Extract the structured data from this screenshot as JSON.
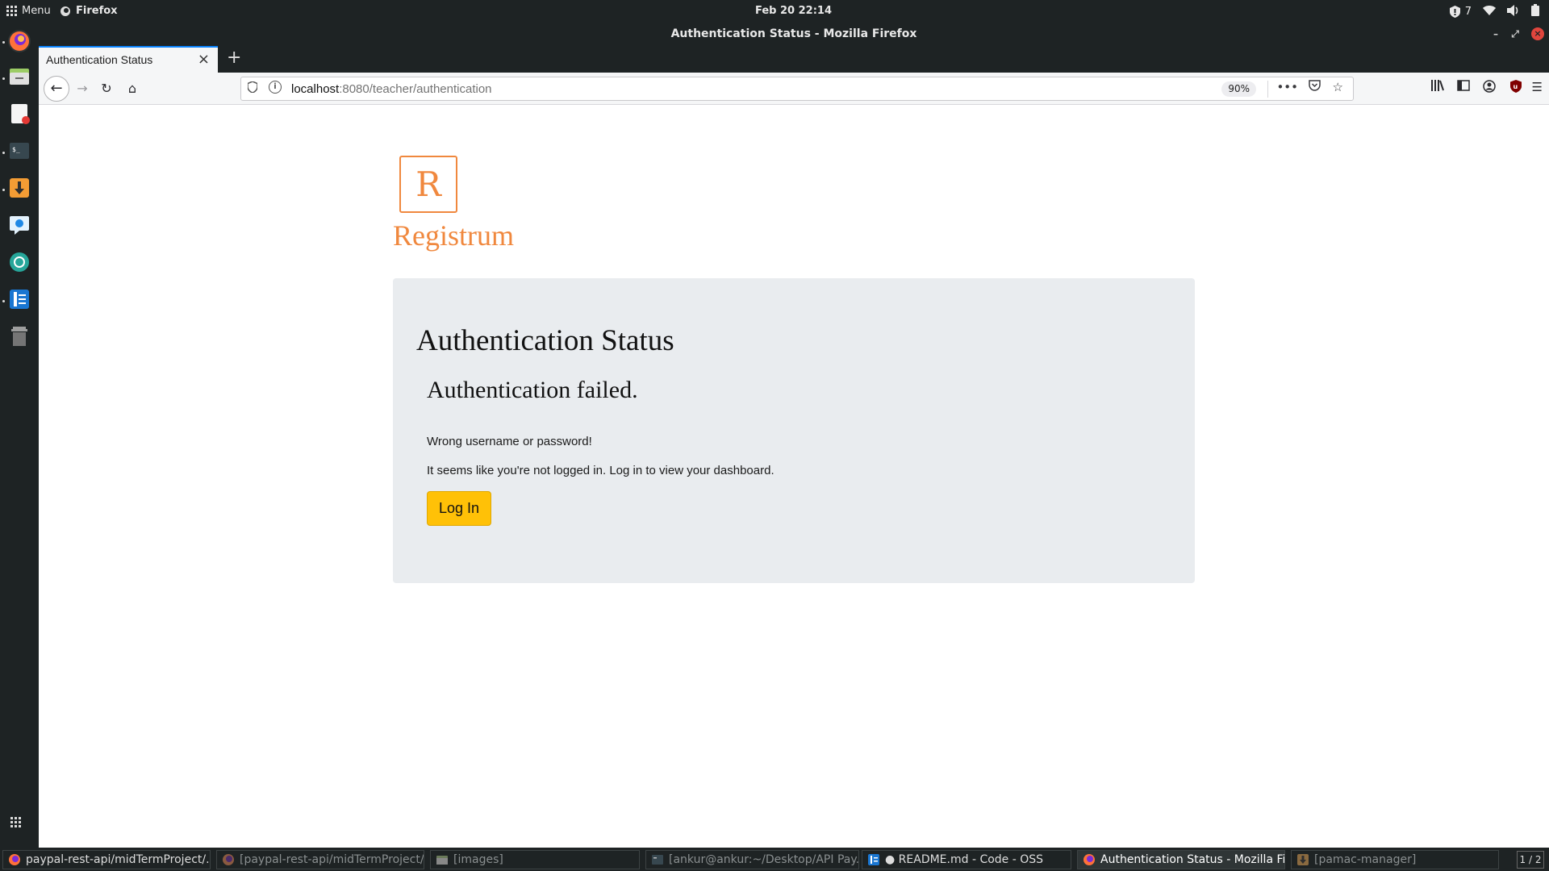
{
  "top_panel": {
    "menu_label": "Menu",
    "app_label": "Firefox",
    "clock": "Feb 20  22:14",
    "update_count": "7"
  },
  "window": {
    "title": "Authentication Status - Mozilla Firefox"
  },
  "browser": {
    "tab_title": "Authentication Status",
    "url_host": "localhost",
    "url_rest": ":8080/teacher/authentication",
    "zoom": "90%"
  },
  "page": {
    "logo_letter": "R",
    "logo_text": "Registrum",
    "heading": "Authentication Status",
    "subheading": "Authentication failed.",
    "error_message": "Wrong username or password!",
    "info_message": "It seems like you're not logged in. Log in to view your dashboard.",
    "login_button": "Log In",
    "colors": {
      "brand": "#f0883e",
      "button": "#ffc107",
      "card": "#e9ecef"
    }
  },
  "taskbar": {
    "items": [
      {
        "label": "paypal-rest-api/midTermProject/...",
        "icon": "firefox-icon"
      },
      {
        "label": "[paypal-rest-api/midTermProject/...",
        "icon": "firefox-icon"
      },
      {
        "label": "[images]",
        "icon": "folder-icon"
      },
      {
        "label": "[ankur@ankur:~/Desktop/API Pay...",
        "icon": "terminal-icon"
      },
      {
        "label": "● README.md - Code - OSS",
        "icon": "code-icon"
      },
      {
        "label": "Authentication Status - Mozilla Fi...",
        "icon": "firefox-icon"
      },
      {
        "label": "[pamac-manager]",
        "icon": "download-icon"
      }
    ],
    "pager": "1 / 2"
  }
}
